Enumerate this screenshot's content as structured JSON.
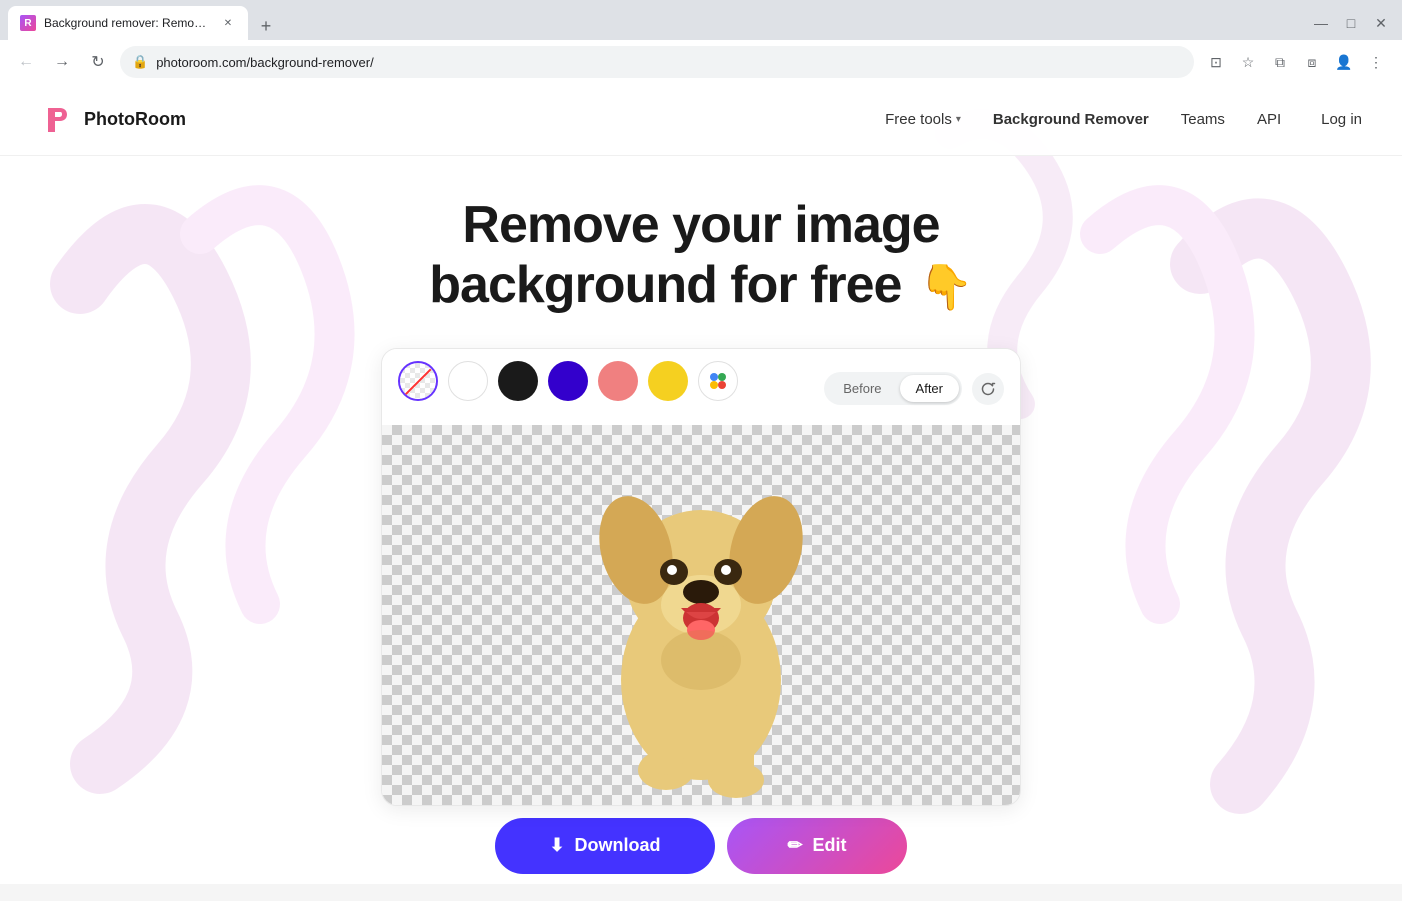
{
  "browser": {
    "tab_title": "Background remover: Remove yo",
    "tab_favicon_letter": "R",
    "url": "photoroom.com/background-remover/",
    "window_controls": {
      "minimize": "—",
      "maximize": "□",
      "close": "✕"
    }
  },
  "nav": {
    "logo_text": "PhotoRoom",
    "links": [
      {
        "label": "Free tools",
        "has_dropdown": true
      },
      {
        "label": "Background Remover",
        "has_dropdown": false,
        "active": true
      },
      {
        "label": "Teams",
        "has_dropdown": false
      },
      {
        "label": "API",
        "has_dropdown": false
      }
    ],
    "login_label": "Log in"
  },
  "hero": {
    "title_line1": "Remove your image",
    "title_line2": "background for free",
    "cursor_emoji": "👇"
  },
  "color_picker": {
    "colors": [
      {
        "id": "transparent",
        "label": "Transparent",
        "active": true
      },
      {
        "id": "white",
        "label": "White"
      },
      {
        "id": "black",
        "label": "Black"
      },
      {
        "id": "purple",
        "label": "Purple"
      },
      {
        "id": "pink",
        "label": "Pink"
      },
      {
        "id": "yellow",
        "label": "Yellow"
      },
      {
        "id": "multicolor",
        "label": "More colors",
        "symbol": "⊕"
      }
    ]
  },
  "before_after": {
    "before_label": "Before",
    "after_label": "After",
    "active": "after"
  },
  "action_buttons": {
    "download_label": "Download",
    "download_icon": "⬇",
    "edit_label": "Edit",
    "edit_icon": "✏"
  }
}
